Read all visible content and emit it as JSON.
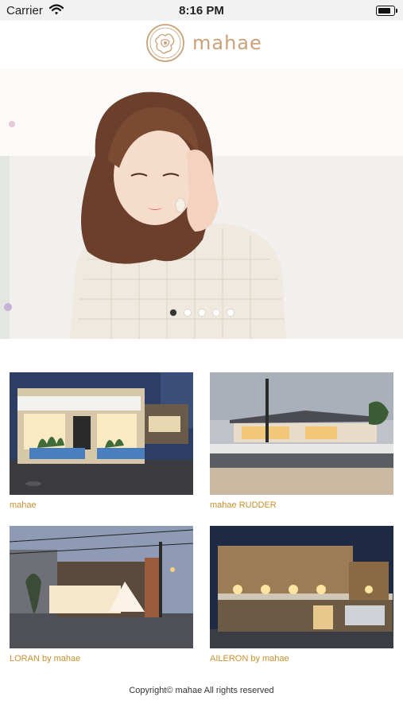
{
  "status_bar": {
    "carrier": "Carrier",
    "time": "8:16 PM",
    "battery_level": 0.85
  },
  "header": {
    "logo_text": "mahae",
    "logo_icon": "floral-emblem-icon",
    "brand_color": "#c9a27a"
  },
  "hero": {
    "slide_count": 5,
    "active_slide": 1
  },
  "salons": [
    {
      "name": "mahae"
    },
    {
      "name": "mahae RUDDER"
    },
    {
      "name": "LORAN by mahae"
    },
    {
      "name": "AILERON by mahae"
    }
  ],
  "footer": {
    "copyright": "Copyright© mahae All rights reserved"
  },
  "colors": {
    "caption": "#c69030",
    "active_dot": "#333333"
  }
}
